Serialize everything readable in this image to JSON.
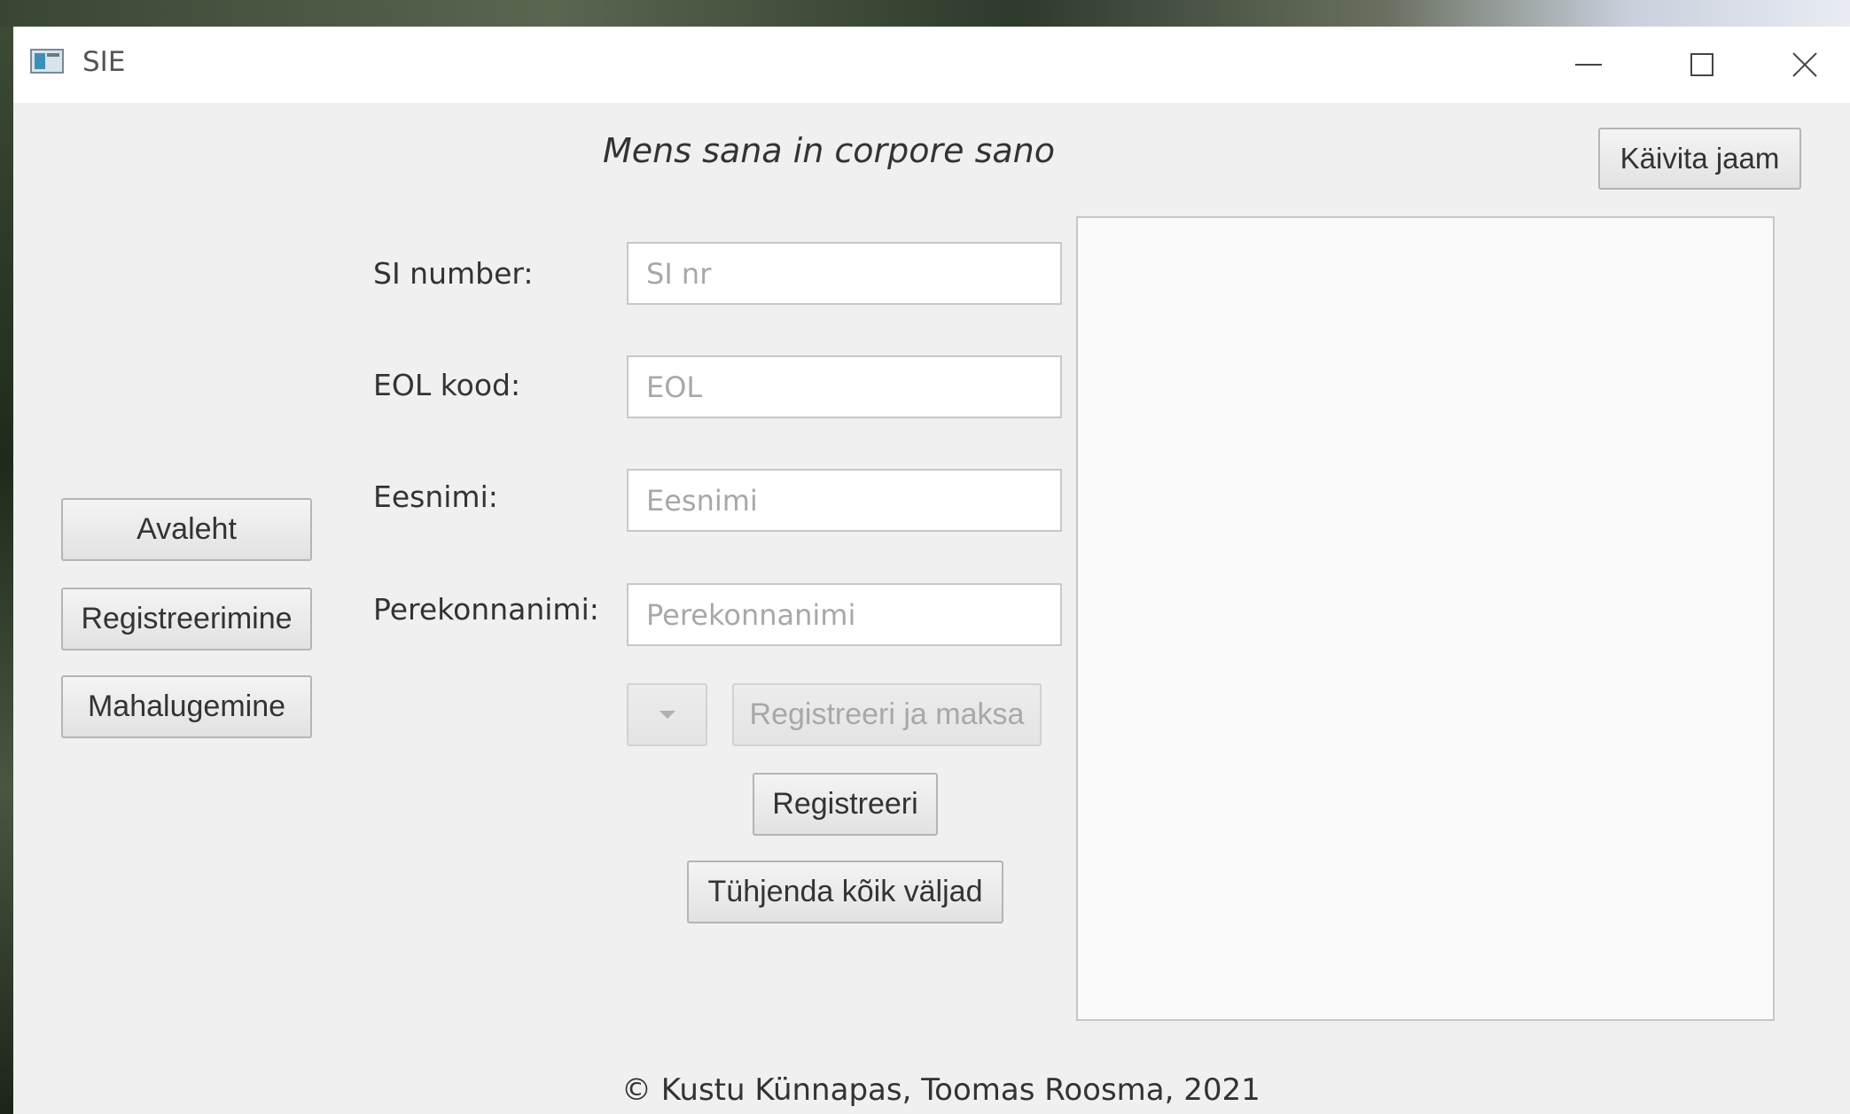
{
  "window": {
    "title": "SIE",
    "controls": {
      "minimize": "minimize",
      "maximize": "maximize",
      "close": "close"
    }
  },
  "header": {
    "motto": "Mens sana in corpore sano",
    "start_station_button": "Käivita jaam"
  },
  "nav": {
    "home": "Avaleht",
    "registration": "Registreerimine",
    "readout": "Mahalugemine"
  },
  "form": {
    "si_number": {
      "label": "SI number:",
      "placeholder": "SI nr",
      "value": ""
    },
    "eol_code": {
      "label": "EOL kood:",
      "placeholder": "EOL",
      "value": ""
    },
    "first_name": {
      "label": "Eesnimi:",
      "placeholder": "Eesnimi",
      "value": ""
    },
    "last_name": {
      "label": "Perekonnanimi:",
      "placeholder": "Perekonnanimi",
      "value": ""
    },
    "payment_select": {
      "selected": ""
    },
    "register_and_pay_button": "Registreeri ja maksa",
    "register_button": "Registreeri",
    "clear_button": "Tühjenda kõik väljad"
  },
  "output": {
    "text": ""
  },
  "footer": {
    "copyright": "© Kustu Künnapas, Toomas Roosma, 2021"
  },
  "icons": {
    "app": "app-window-icon",
    "minimize": "minimize-icon",
    "maximize": "maximize-icon",
    "close": "close-icon",
    "dropdown": "chevron-down-icon"
  }
}
